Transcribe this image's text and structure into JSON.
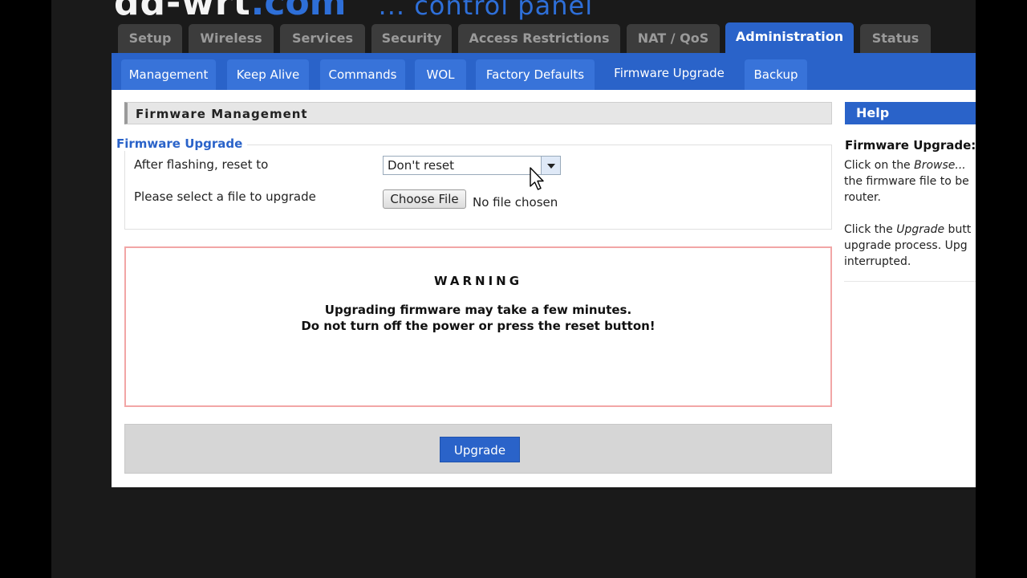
{
  "logo": {
    "main": "dd-wrt",
    "domain": ".com",
    "sub": "... control panel"
  },
  "top_tabs": [
    {
      "label": "Setup",
      "active": false
    },
    {
      "label": "Wireless",
      "active": false
    },
    {
      "label": "Services",
      "active": false
    },
    {
      "label": "Security",
      "active": false
    },
    {
      "label": "Access Restrictions",
      "active": false
    },
    {
      "label": "NAT / QoS",
      "active": false
    },
    {
      "label": "Administration",
      "active": true
    },
    {
      "label": "Status",
      "active": false
    }
  ],
  "sub_tabs": [
    {
      "label": "Management",
      "active": false
    },
    {
      "label": "Keep Alive",
      "active": false
    },
    {
      "label": "Commands",
      "active": false
    },
    {
      "label": "WOL",
      "active": false
    },
    {
      "label": "Factory Defaults",
      "active": false
    },
    {
      "label": "Firmware Upgrade",
      "active": true
    },
    {
      "label": "Backup",
      "active": false
    }
  ],
  "main": {
    "section_title": "Firmware Management",
    "legend": "Firmware Upgrade",
    "reset_label": "After flashing, reset to",
    "reset_value": "Don't reset",
    "file_label": "Please select a file to upgrade",
    "choose_file_label": "Choose File",
    "no_file_text": "No file chosen",
    "warning": {
      "title": "WARNING",
      "line1": "Upgrading firmware may take a few minutes.",
      "line2": "Do not turn off the power or press the reset button!"
    },
    "upgrade_label": "Upgrade"
  },
  "help": {
    "header": "Help",
    "title": "Firmware Upgrade:",
    "p1_line1_pre": "Click on the ",
    "p1_line1_em": "Browse...",
    "p1_line2": "the firmware file to be",
    "p1_line3": "router.",
    "p2_line1_pre": "Click the ",
    "p2_line1_em": "Upgrade",
    "p2_line1_post": " butt",
    "p2_line2": "upgrade process. Upg",
    "p2_line3": "interrupted."
  },
  "colors": {
    "accent": "#2a63c9",
    "tab_inactive": "#3c3c3c",
    "warning_border": "#f2a6a6"
  }
}
